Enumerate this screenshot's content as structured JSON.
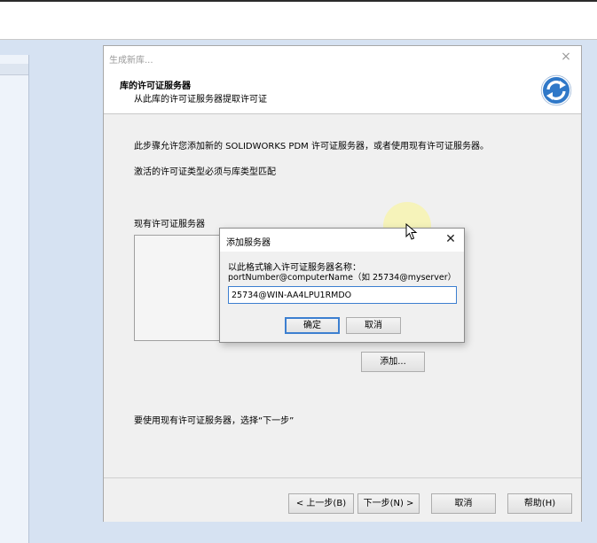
{
  "wizard": {
    "window_title": "生成新库...",
    "close_glyph": "×",
    "header_title": "库的许可证服务器",
    "header_subtitle": "从此库的许可证服务器提取许可证",
    "intro_text": "此步骤允许您添加新的 SOLIDWORKS PDM 许可证服务器，或者使用现有许可证服务器。",
    "note_text": "激活的许可证类型必须与库类型匹配",
    "existing_label": "现有许可证服务器",
    "add_button": "添加...",
    "hint_text": "要使用现有许可证服务器，选择“下一步”",
    "footer": {
      "back": "< 上一步(B)",
      "next": "下一步(N) >",
      "cancel": "取消",
      "help": "帮助(H)"
    }
  },
  "add_server_dialog": {
    "title": "添加服务器",
    "close_glyph": "✕",
    "prompt_line1": "以此格式输入许可证服务器名称：",
    "prompt_line2": "portNumber@computerName（如 25734@myserver）",
    "input_value": "25734@WIN-AA4LPU1RMDO",
    "ok": "确定",
    "cancel": "取消"
  },
  "icons": {
    "wizard_logo": "pdm-sync-arrows-icon",
    "cursor": "mouse-pointer-icon"
  },
  "colors": {
    "desktop": "#d6e2f2",
    "focus_border": "#3c7fd0",
    "highlight": "#faf596"
  }
}
